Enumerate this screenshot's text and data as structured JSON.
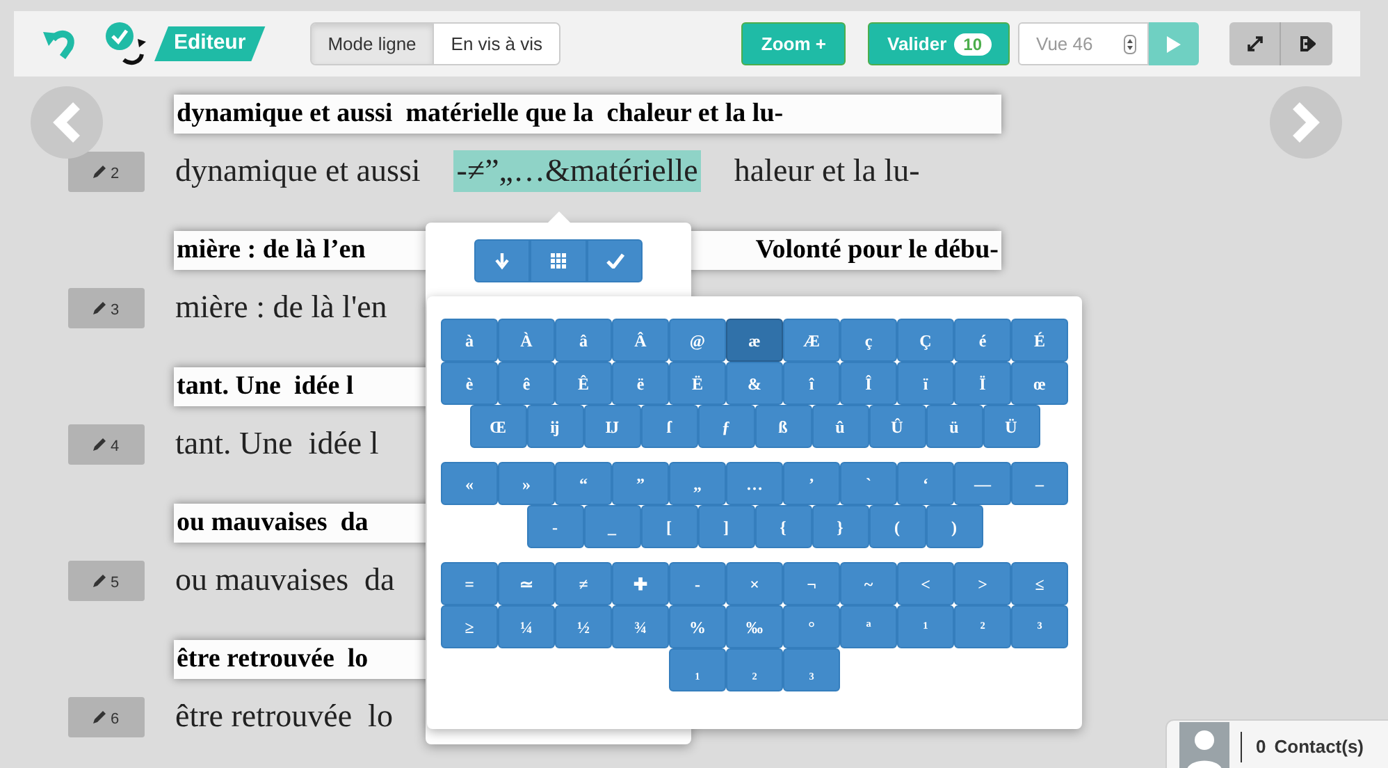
{
  "toolbar": {
    "brand": "Editeur",
    "view_modes": [
      {
        "label": "Mode ligne",
        "selected": true
      },
      {
        "label": "En vis à vis",
        "selected": false
      }
    ],
    "zoom_button": "Zoom +",
    "validate_button": {
      "label": "Valider",
      "count": "10"
    },
    "page_field": {
      "value": "Vue 46"
    }
  },
  "lines": [
    {
      "number": "2",
      "scan_left": "dynamique et aussi  matérielle que la  chaleur et la lu-",
      "ocr": [
        {
          "kind": "text",
          "text": "dynamique et aussi"
        },
        {
          "kind": "selection",
          "text": "-≠”„…&matérielle"
        },
        {
          "kind": "text",
          "text": "haleur et la lu-"
        }
      ]
    },
    {
      "number": "3",
      "scan_left": "mière : de là l’en",
      "scan_right": "Volonté pour le débu-",
      "ocr": [
        {
          "kind": "text",
          "text": "mière : de là l'en"
        }
      ]
    },
    {
      "number": "4",
      "scan_left": "tant. Une  idée l",
      "ocr": [
        {
          "kind": "text",
          "text": "tant. Une  idée l"
        }
      ]
    },
    {
      "number": "5",
      "scan_left": "ou mauvaises  da",
      "ocr": [
        {
          "kind": "text",
          "text": "ou mauvaises  da"
        }
      ]
    },
    {
      "number": "6",
      "scan_left": "être retrouvée  lo",
      "ocr": [
        {
          "kind": "text",
          "text": "être retrouvée  lo"
        }
      ]
    }
  ],
  "keyboard": {
    "groups": [
      {
        "keys": [
          {
            "key": "à",
            "selected": false
          },
          {
            "key": "À",
            "selected": false
          },
          {
            "key": "â",
            "selected": false
          },
          {
            "key": "Â",
            "selected": false
          },
          {
            "key": "@",
            "selected": false
          },
          {
            "key": "æ",
            "selected": true
          },
          {
            "key": "Æ",
            "selected": false
          },
          {
            "key": "ç",
            "selected": false
          },
          {
            "key": "Ç",
            "selected": false
          },
          {
            "key": "é",
            "selected": false
          },
          {
            "key": "É",
            "selected": false
          },
          {
            "key": "è",
            "selected": false
          },
          {
            "key": "ê",
            "selected": false
          },
          {
            "key": "Ê",
            "selected": false
          },
          {
            "key": "ë",
            "selected": false
          },
          {
            "key": "Ë",
            "selected": false
          },
          {
            "key": "&",
            "selected": false
          },
          {
            "key": "î",
            "selected": false
          },
          {
            "key": "Î",
            "selected": false
          },
          {
            "key": "ï",
            "selected": false
          },
          {
            "key": "Ï",
            "selected": false
          },
          {
            "key": "œ",
            "selected": false
          },
          {
            "key": "Œ",
            "selected": false
          },
          {
            "key": "ĳ",
            "selected": false
          },
          {
            "key": "Ĳ",
            "selected": false
          },
          {
            "key": "ſ",
            "selected": false
          },
          {
            "key": "ƒ",
            "selected": false
          },
          {
            "key": "ß",
            "selected": false
          },
          {
            "key": "û",
            "selected": false
          },
          {
            "key": "Û",
            "selected": false
          },
          {
            "key": "ü",
            "selected": false
          },
          {
            "key": "Ü",
            "selected": false
          }
        ]
      },
      {
        "keys": [
          {
            "key": "«",
            "selected": false
          },
          {
            "key": "»",
            "selected": false
          },
          {
            "key": "“",
            "selected": false
          },
          {
            "key": "”",
            "selected": false
          },
          {
            "key": "„",
            "selected": false
          },
          {
            "key": "…",
            "selected": false
          },
          {
            "key": "’",
            "selected": false
          },
          {
            "key": "`",
            "selected": false
          },
          {
            "key": "‘",
            "selected": false
          },
          {
            "key": "—",
            "selected": false
          },
          {
            "key": "–",
            "selected": false
          },
          {
            "key": "-",
            "selected": false
          },
          {
            "key": "_",
            "selected": false
          },
          {
            "key": "[",
            "selected": false
          },
          {
            "key": "]",
            "selected": false
          },
          {
            "key": "{",
            "selected": false
          },
          {
            "key": "}",
            "selected": false
          },
          {
            "key": "(",
            "selected": false
          },
          {
            "key": ")",
            "selected": false
          }
        ]
      },
      {
        "keys": [
          {
            "key": "=",
            "selected": false
          },
          {
            "key": "≃",
            "selected": false
          },
          {
            "key": "≠",
            "selected": false
          },
          {
            "key": "✚",
            "selected": false
          },
          {
            "key": "-",
            "selected": false
          },
          {
            "key": "×",
            "selected": false
          },
          {
            "key": "¬",
            "selected": false
          },
          {
            "key": "~",
            "selected": false
          },
          {
            "key": "<",
            "selected": false
          },
          {
            "key": ">",
            "selected": false
          },
          {
            "key": "≤",
            "selected": false
          },
          {
            "key": "≥",
            "selected": false
          },
          {
            "key": "¼",
            "selected": false
          },
          {
            "key": "½",
            "selected": false
          },
          {
            "key": "¾",
            "selected": false
          },
          {
            "key": "%",
            "selected": false
          },
          {
            "key": "‰",
            "selected": false
          },
          {
            "key": "°",
            "selected": false
          },
          {
            "key": "ª",
            "selected": false
          },
          {
            "key": "¹",
            "selected": false
          },
          {
            "key": "²",
            "selected": false
          },
          {
            "key": "³",
            "selected": false
          },
          {
            "key": "₁",
            "selected": false
          },
          {
            "key": "₂",
            "selected": false
          },
          {
            "key": "₃",
            "selected": false
          }
        ]
      }
    ]
  },
  "contacts": {
    "count": "0",
    "label": "Contact(s)"
  }
}
